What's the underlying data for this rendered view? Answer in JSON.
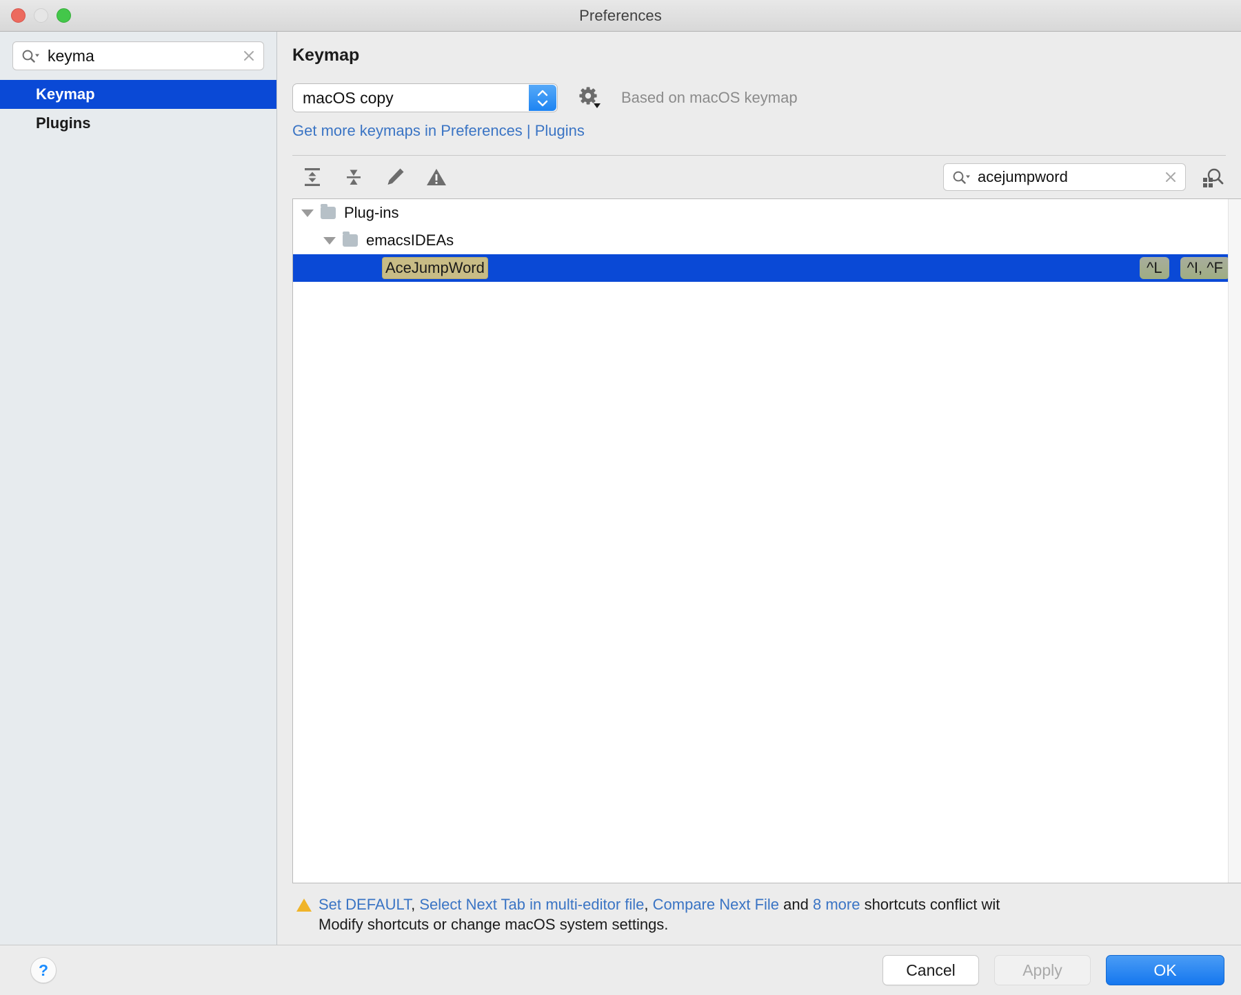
{
  "window": {
    "title": "Preferences",
    "traffic_lights": [
      "close-button",
      "minimize-button",
      "zoom-button"
    ]
  },
  "sidebar": {
    "search": {
      "value": "keyma",
      "placeholder": "",
      "clear_label": "×"
    },
    "items": [
      {
        "label": "Keymap",
        "selected": true
      },
      {
        "label": "Plugins",
        "selected": false
      }
    ]
  },
  "main": {
    "page_title": "Keymap",
    "keymap_select": {
      "value": "macOS copy"
    },
    "based_on": "Based on macOS keymap",
    "get_more_link": "Get more keymaps in Preferences | Plugins",
    "toolbar": {
      "expand_all": "Expand All",
      "collapse_all": "Collapse All",
      "edit_shortcut": "Edit Shortcut",
      "show_conflicts": "Show Conflicts",
      "search": {
        "value": "acejumpword",
        "clear_label": "×"
      },
      "find_by_shortcut": "Find Actions by Shortcut"
    },
    "tree": {
      "rows": [
        {
          "label": "Plug-ins",
          "depth": 1,
          "type": "folder",
          "expanded": true,
          "selected": false
        },
        {
          "label": "emacsIDEAs",
          "depth": 2,
          "type": "folder",
          "expanded": true,
          "selected": false
        },
        {
          "label": "AceJumpWord",
          "depth": 3,
          "type": "action",
          "selected": true,
          "highlighted": true,
          "shortcuts": [
            "^L",
            "^I, ^F"
          ]
        }
      ]
    },
    "conflict": {
      "link1": "Set DEFAULT",
      "sep1": ", ",
      "link2": "Select Next Tab in multi-editor file",
      "sep2": ", ",
      "link3": "Compare Next File",
      "sep3": " and ",
      "link4": "8 more",
      "tail": " shortcuts conflict wit",
      "line2": "Modify shortcuts or change macOS system settings."
    }
  },
  "footer": {
    "help": "?",
    "cancel": "Cancel",
    "apply": "Apply",
    "ok": "OK"
  },
  "colors": {
    "accent_blue": "#0a49d6",
    "link_blue": "#3a74c4",
    "ok_blue": "#1577ef",
    "warning_amber": "#f0b429",
    "match_highlight": "#c8bc85",
    "shortcut_badge": "#9fad82"
  }
}
